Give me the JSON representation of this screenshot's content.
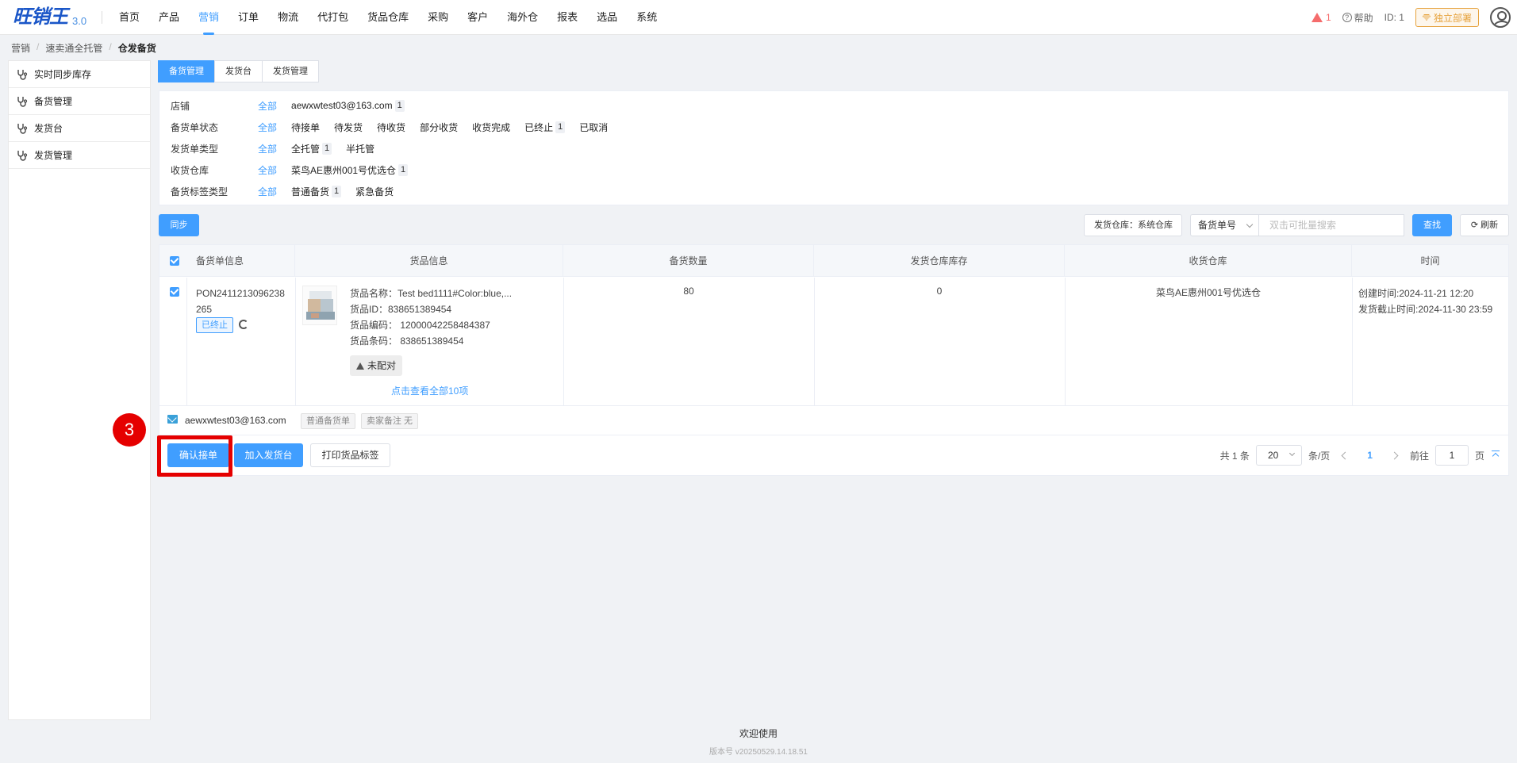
{
  "app": {
    "logo_text": "旺销王",
    "logo_version": "3.0"
  },
  "nav": [
    {
      "label": "首页"
    },
    {
      "label": "产品"
    },
    {
      "label": "营销",
      "active": true
    },
    {
      "label": "订单"
    },
    {
      "label": "物流"
    },
    {
      "label": "代打包"
    },
    {
      "label": "货品仓库"
    },
    {
      "label": "采购"
    },
    {
      "label": "客户"
    },
    {
      "label": "海外仓"
    },
    {
      "label": "报表"
    },
    {
      "label": "选品"
    },
    {
      "label": "系统"
    }
  ],
  "topright": {
    "warning_count": "1",
    "help_label": "帮助",
    "id_label": "ID: 1",
    "deploy_label": "独立部署"
  },
  "breadcrumb": [
    "营销",
    "速卖通全托管",
    "仓发备货"
  ],
  "sidebar": {
    "items": [
      {
        "label": "实时同步库存"
      },
      {
        "label": "备货管理"
      },
      {
        "label": "发货台"
      },
      {
        "label": "发货管理"
      }
    ]
  },
  "tabs": [
    {
      "label": "备货管理",
      "active": true
    },
    {
      "label": "发货台"
    },
    {
      "label": "发货管理"
    }
  ],
  "filters": [
    {
      "label": "店铺",
      "all": "全部",
      "options": [
        {
          "label": "aewxwtest03@163.com",
          "count": "1"
        }
      ]
    },
    {
      "label": "备货单状态",
      "all": "全部",
      "options": [
        {
          "label": "待接单"
        },
        {
          "label": "待发货"
        },
        {
          "label": "待收货"
        },
        {
          "label": "部分收货"
        },
        {
          "label": "收货完成"
        },
        {
          "label": "已终止",
          "count": "1"
        },
        {
          "label": "已取消"
        }
      ]
    },
    {
      "label": "发货单类型",
      "all": "全部",
      "options": [
        {
          "label": "全托管",
          "count": "1"
        },
        {
          "label": "半托管"
        }
      ]
    },
    {
      "label": "收货仓库",
      "all": "全部",
      "options": [
        {
          "label": "菜鸟AE惠州001号优选仓",
          "count": "1"
        }
      ]
    },
    {
      "label": "备货标签类型",
      "all": "全部",
      "options": [
        {
          "label": "普通备货",
          "count": "1"
        },
        {
          "label": "紧急备货"
        }
      ]
    }
  ],
  "toolbar": {
    "sync_label": "同步",
    "warehouse_select": "发货仓库：系统仓库",
    "search_type": "备货单号",
    "search_placeholder": "双击可批量搜索",
    "search_label": "查找",
    "refresh_label": "刷新"
  },
  "table": {
    "headers": [
      "备货单信息",
      "货品信息",
      "备货数量",
      "发货仓库库存",
      "收货仓库",
      "时间"
    ],
    "row": {
      "order_no": "PON2411213096238265",
      "status": "已终止",
      "product_name": "货品名称：Test bed1111#Color:blue,...",
      "product_id": "货品ID：838651389454",
      "product_code": "货品编码：  12000042258484387",
      "product_barcode": "货品条码：  838651389454",
      "match_status": "未配对",
      "view_all": "点击查看全部10项",
      "quantity": "80",
      "stock": "0",
      "receive_warehouse": "菜鸟AE惠州001号优选仓",
      "created_time": "创建时间:2024-11-21 12:20",
      "deadline_time": "发货截止时间:2024-11-30 23:59"
    },
    "shop_row": {
      "email": "aewxwtest03@163.com",
      "tag_type": "普通备货单",
      "seller_note": "卖家备注 无"
    }
  },
  "actions": {
    "confirm_label": "确认接单",
    "add_label": "加入发货台",
    "print_label": "打印货品标签"
  },
  "annotation": {
    "step": "3"
  },
  "pager": {
    "total": "共 1 条",
    "page_size": "20",
    "per_page": "条/页",
    "current": "1",
    "goto_label": "前往",
    "goto_value": "1",
    "page_unit": "页"
  },
  "footer": {
    "title": "欢迎使用",
    "version": "版本号 v20250529.14.18.51"
  },
  "colors": {
    "primary": "#409eff",
    "highlight": "#e50000",
    "warning": "#f56c6c",
    "deploy": "#e6a23c"
  }
}
